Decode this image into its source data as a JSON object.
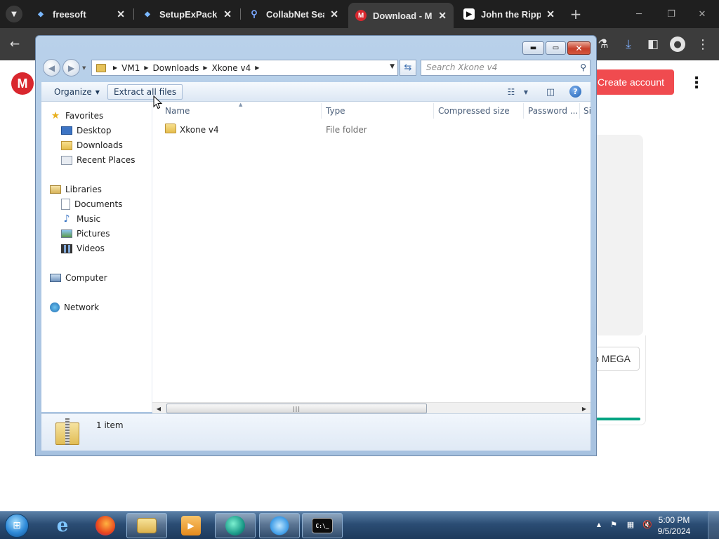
{
  "browser": {
    "tabs": [
      {
        "label": "freesoft",
        "favicon": "bird-icon",
        "active": false
      },
      {
        "label": "SetupExPack",
        "favicon": "bird-icon",
        "active": false
      },
      {
        "label": "CollabNet Sear",
        "favicon": "search-icon",
        "active": false
      },
      {
        "label": "Download - MEGA",
        "favicon": "mega-icon",
        "active": true
      },
      {
        "label": "John the Ripper",
        "favicon": "page-icon",
        "active": false
      }
    ],
    "tab_close_glyph": "✕",
    "new_tab_glyph": "+",
    "page": {
      "logo_letter": "M",
      "create_account_label": "Create account",
      "mega_button_label": "o MEGA",
      "brand_color": "#d9272e",
      "accent_color": "#00a382"
    }
  },
  "explorer": {
    "breadcrumb": [
      "VM1",
      "Downloads",
      "Xkone v4"
    ],
    "search_placeholder": "Search Xkone v4",
    "commands": {
      "organize_label": "Organize",
      "extract_label": "Extract all files"
    },
    "nav": {
      "favorites": {
        "label": "Favorites",
        "items": [
          "Desktop",
          "Downloads",
          "Recent Places"
        ]
      },
      "libraries": {
        "label": "Libraries",
        "items": [
          "Documents",
          "Music",
          "Pictures",
          "Videos"
        ]
      },
      "computer_label": "Computer",
      "network_label": "Network"
    },
    "columns": [
      "Name",
      "Type",
      "Compressed size",
      "Password ...",
      "Si"
    ],
    "files": [
      {
        "name": "Xkone v4",
        "type": "File folder"
      }
    ],
    "status_text": "1 item"
  },
  "taskbar": {
    "time": "5:00 PM",
    "date": "9/5/2024",
    "apps": [
      "internet-explorer-icon",
      "firefox-icon",
      "file-explorer-icon",
      "media-player-icon",
      "browser-icon",
      "network-app-icon",
      "cmd-icon"
    ]
  }
}
